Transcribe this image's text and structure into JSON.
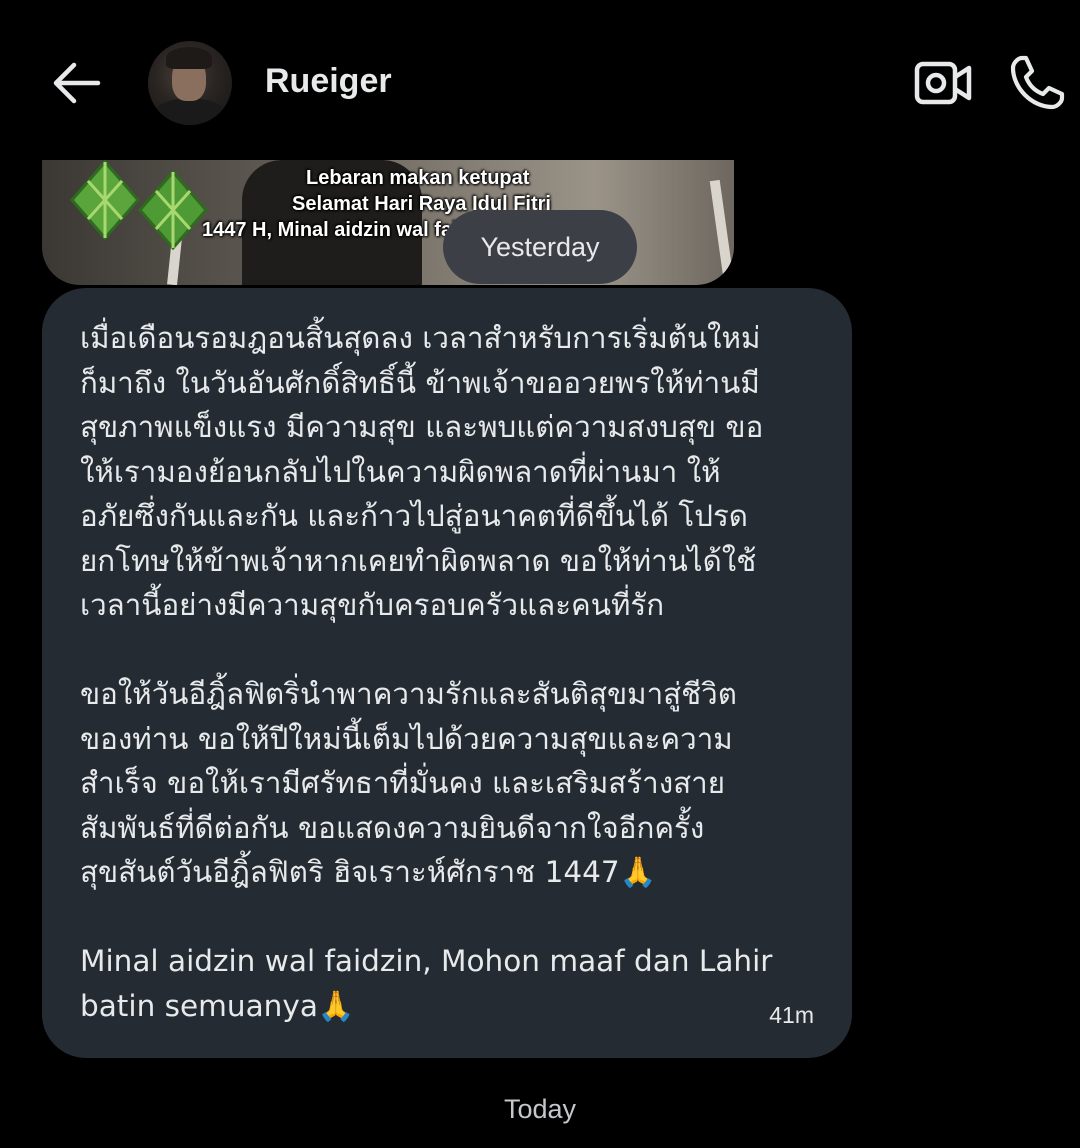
{
  "header": {
    "back_icon": "arrow-left-icon",
    "contact_name": "Rueiger",
    "video_icon": "video-camera-icon",
    "call_icon": "phone-icon"
  },
  "image_card": {
    "lines": [
      "Lebaran makan ketupat",
      "Selamat Hari Raya Idul Fitri",
      "1447 H,  Minal aidzin wal faidzin"
    ]
  },
  "separators": {
    "yesterday": "Yesterday",
    "today": "Today"
  },
  "message": {
    "text": "เมื่อเดือนรอมฎอนสิ้นสุดลง เวลาสำหรับการเริ่มต้นใหม่\nก็มาถึง ในวันอันศักดิ์สิทธิ์นี้ ข้าพเจ้าขออวยพรให้ท่านมี\nสุขภาพแข็งแรง มีความสุข และพบแต่ความสงบสุข ขอ\nให้เรามองย้อนกลับไปในความผิดพลาดที่ผ่านมา ให้\nอภัยซึ่งกันและกัน และก้าวไปสู่อนาคตที่ดีขึ้นได้ โปรด\nยกโทษให้ข้าพเจ้าหากเคยทำผิดพลาด ขอให้ท่านได้ใช้\nเวลานี้อย่างมีความสุขกับครอบครัวและคนที่รัก\n\nขอให้วันอีฎิ้ลฟิตริ่นำพาความรักและสันติสุขมาสู่ชีวิต\nของท่าน ขอให้ปีใหม่นี้เต็มไปด้วยความสุขและความ\nสำเร็จ ขอให้เรามีศรัทธาที่มั่นคง และเสริมสร้างสาย\nสัมพันธ์ที่ดีต่อกัน ขอแสดงความยินดีจากใจอีกครั้ง\nสุขสันต์วันอีฎิ้ลฟิตริ ฮิจเราะห์ศักราช 1447🙏\n\nMinal aidzin wal faidzin, Mohon maaf dan Lahir\nbatin semuanya🙏",
    "time": "41m"
  }
}
